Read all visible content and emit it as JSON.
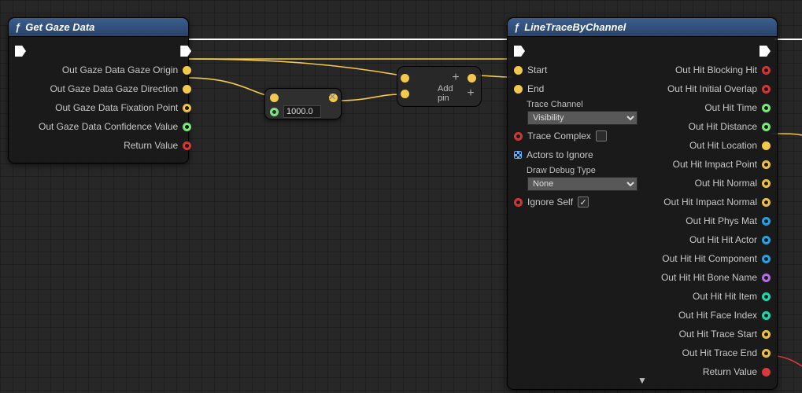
{
  "nodeA": {
    "title": "Get Gaze Data",
    "outs": {
      "origin": "Out Gaze Data Gaze Origin",
      "direction": "Out Gaze Data Gaze Direction",
      "fixation": "Out Gaze Data Fixation Point",
      "confidence": "Out Gaze Data Confidence Value",
      "return": "Return Value"
    }
  },
  "mult": {
    "value": "1000.0",
    "op": "×"
  },
  "addpin": {
    "label": "Add pin",
    "op": "+"
  },
  "nodeB": {
    "title": "LineTraceByChannel",
    "ins": {
      "start": "Start",
      "end": "End",
      "traceChannelLabel": "Trace Channel",
      "traceChannelValue": "Visibility",
      "traceComplex": "Trace Complex",
      "actorsToIgnore": "Actors to Ignore",
      "drawDebugLabel": "Draw Debug Type",
      "drawDebugValue": "None",
      "ignoreSelf": "Ignore Self"
    },
    "outs": {
      "blockingHit": "Out Hit Blocking Hit",
      "initialOverlap": "Out Hit Initial Overlap",
      "time": "Out Hit Time",
      "distance": "Out Hit Distance",
      "location": "Out Hit Location",
      "impactPoint": "Out Hit Impact Point",
      "normal": "Out Hit Normal",
      "impactNormal": "Out Hit Impact Normal",
      "physMat": "Out Hit Phys Mat",
      "hitActor": "Out Hit Hit Actor",
      "hitComponent": "Out Hit Hit Component",
      "hitBoneName": "Out Hit Hit Bone Name",
      "hitItem": "Out Hit Hit Item",
      "faceIndex": "Out Hit Face Index",
      "traceStart": "Out Hit Trace Start",
      "traceEnd": "Out Hit Trace End",
      "return": "Return Value"
    }
  }
}
